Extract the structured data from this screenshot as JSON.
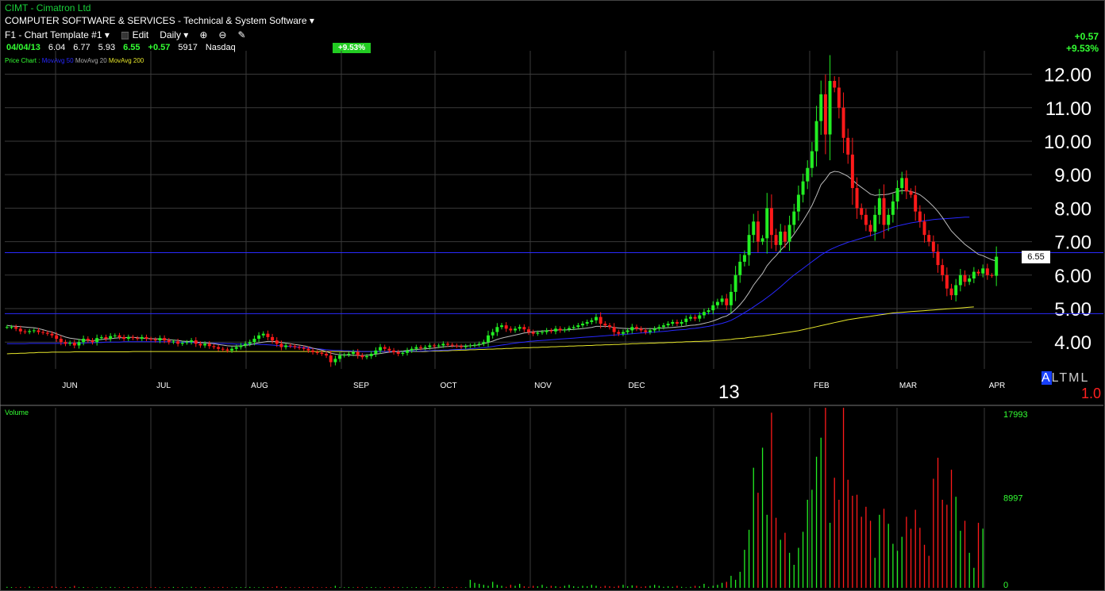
{
  "header": {
    "symbol_line": "CIMT - Cimatron Ltd",
    "industry": "COMPUTER SOFTWARE & SERVICES - Technical & System Software",
    "template": "F1 - Chart Template #1",
    "edit_label": "Edit",
    "period": "Daily"
  },
  "quote": {
    "date": "04/04/13",
    "open": "6.04",
    "high": "6.77",
    "low": "5.93",
    "last": "6.55",
    "change": "+0.57",
    "volume": "5917",
    "exchange": "Nasdaq",
    "pct_badge": "+9.53%"
  },
  "right_change": {
    "points": "+0.57",
    "percent": "+9.53%"
  },
  "legend": {
    "price": "Price Chart :",
    "ma50": "MovAvg 50",
    "ma20": "MovAvg 20",
    "ma200": "MovAvg 200"
  },
  "year_label": "13",
  "scale_modes": {
    "a": "A",
    "l": "L",
    "t": "T",
    "m": "M",
    "l2": "L"
  },
  "scale_value": "1.0",
  "volume_label": "Volume",
  "colors": {
    "up": "#22ee22",
    "down": "#ff1a1a",
    "ma20": "#bbbbbb",
    "ma50": "#2828ff",
    "ma200": "#e6e62a",
    "grid": "#3a3a3a",
    "hline": "#2a2aff"
  },
  "chart_data": [
    {
      "type": "candlestick",
      "title": "CIMT - Cimatron Ltd",
      "y_tick_labels": [
        "12.00",
        "11.00",
        "10.00",
        "9.00",
        "8.00",
        "7.00",
        "6.00",
        "5.00",
        "4.00"
      ],
      "ylim": [
        3.2,
        12.7
      ],
      "month_labels": [
        "JUN",
        "JUL",
        "AUG",
        "SEP",
        "OCT",
        "NOV",
        "DEC",
        "FEB",
        "MAR",
        "APR"
      ],
      "last_price_label": "6.55",
      "horizontal_lines": [
        6.67,
        4.85
      ],
      "close": [
        4.45,
        4.45,
        4.4,
        4.32,
        4.3,
        4.33,
        4.35,
        4.3,
        4.28,
        4.25,
        4.2,
        4.1,
        4.0,
        3.95,
        3.98,
        3.9,
        4.0,
        4.1,
        4.05,
        4.0,
        4.12,
        4.15,
        4.1,
        4.18,
        4.2,
        4.15,
        4.1,
        4.15,
        4.12,
        4.1,
        4.15,
        4.1,
        4.08,
        4.05,
        4.12,
        4.05,
        4.0,
        4.02,
        3.95,
        3.98,
        4.0,
        4.05,
        3.95,
        3.9,
        3.95,
        3.88,
        3.85,
        3.8,
        3.78,
        3.75,
        3.8,
        3.85,
        3.9,
        3.95,
        4.0,
        4.1,
        4.2,
        4.25,
        4.15,
        4.05,
        3.95,
        3.85,
        3.9,
        3.88,
        3.85,
        3.83,
        3.8,
        3.75,
        3.7,
        3.68,
        3.65,
        3.6,
        3.4,
        3.5,
        3.6,
        3.62,
        3.65,
        3.7,
        3.6,
        3.55,
        3.58,
        3.65,
        3.75,
        3.85,
        3.8,
        3.75,
        3.7,
        3.65,
        3.68,
        3.75,
        3.8,
        3.85,
        3.82,
        3.85,
        3.9,
        3.88,
        3.9,
        3.95,
        3.92,
        3.9,
        3.88,
        3.85,
        3.88,
        3.9,
        3.92,
        3.95,
        4.0,
        4.2,
        4.3,
        4.45,
        4.5,
        4.4,
        4.35,
        4.4,
        4.45,
        4.38,
        4.3,
        4.25,
        4.28,
        4.3,
        4.35,
        4.32,
        4.4,
        4.35,
        4.38,
        4.42,
        4.45,
        4.5,
        4.55,
        4.6,
        4.65,
        4.75,
        4.55,
        4.5,
        4.45,
        4.3,
        4.25,
        4.3,
        4.35,
        4.45,
        4.4,
        4.35,
        4.3,
        4.35,
        4.4,
        4.45,
        4.5,
        4.55,
        4.6,
        4.55,
        4.6,
        4.7,
        4.75,
        4.7,
        4.8,
        4.9,
        4.95,
        5.1,
        5.2,
        5.3,
        5.1,
        5.5,
        6.0,
        6.4,
        6.6,
        7.2,
        7.6,
        7.0,
        7.1,
        8.0,
        7.2,
        6.9,
        7.3,
        7.0,
        7.5,
        7.9,
        8.4,
        8.8,
        9.2,
        9.7,
        10.6,
        11.4,
        10.2,
        11.8,
        11.6,
        11.0,
        10.1,
        9.6,
        8.6,
        8.0,
        7.8,
        7.5,
        7.3,
        7.8,
        8.3,
        7.5,
        7.8,
        8.2,
        8.6,
        8.9,
        8.5,
        8.4,
        7.9,
        7.6,
        7.2,
        7.0,
        6.7,
        6.3,
        6.0,
        5.6,
        5.4,
        5.7,
        6.0,
        5.8,
        5.9,
        6.1,
        6.05,
        6.2,
        6.0,
        5.98,
        6.55
      ],
      "ma20": [
        4.5,
        4.48,
        4.47,
        4.46,
        4.45,
        4.44,
        4.43,
        4.4,
        4.37,
        4.33,
        4.3,
        4.25,
        4.2,
        4.15,
        4.12,
        4.1,
        4.08,
        4.06,
        4.05,
        4.04,
        4.06,
        4.08,
        4.09,
        4.1,
        4.12,
        4.13,
        4.13,
        4.14,
        4.14,
        4.13,
        4.12,
        4.11,
        4.1,
        4.1,
        4.09,
        4.08,
        4.07,
        4.06,
        4.05,
        4.03,
        4.02,
        4.02,
        4.0,
        3.99,
        3.98,
        3.97,
        3.95,
        3.93,
        3.91,
        3.89,
        3.88,
        3.88,
        3.89,
        3.9,
        3.92,
        3.95,
        3.98,
        4.0,
        4.02,
        4.02,
        4.01,
        3.99,
        3.97,
        3.95,
        3.93,
        3.91,
        3.89,
        3.86,
        3.82,
        3.79,
        3.76,
        3.72,
        3.67,
        3.64,
        3.62,
        3.62,
        3.61,
        3.61,
        3.6,
        3.6,
        3.61,
        3.62,
        3.64,
        3.66,
        3.68,
        3.7,
        3.71,
        3.72,
        3.73,
        3.75,
        3.76,
        3.78,
        3.79,
        3.8,
        3.81,
        3.82,
        3.84,
        3.86,
        3.87,
        3.88,
        3.88,
        3.88,
        3.88,
        3.89,
        3.9,
        3.92,
        3.95,
        3.99,
        4.03,
        4.08,
        4.12,
        4.15,
        4.18,
        4.21,
        4.24,
        4.27,
        4.29,
        4.31,
        4.32,
        4.33,
        4.34,
        4.35,
        4.36,
        4.36,
        4.36,
        4.37,
        4.38,
        4.39,
        4.4,
        4.42,
        4.44,
        4.47,
        4.47,
        4.47,
        4.46,
        4.44,
        4.42,
        4.41,
        4.4,
        4.4,
        4.4,
        4.4,
        4.4,
        4.4,
        4.4,
        4.41,
        4.42,
        4.43,
        4.44,
        4.45,
        4.46,
        4.48,
        4.5,
        4.51,
        4.53,
        4.56,
        4.59,
        4.63,
        4.68,
        4.74,
        4.78,
        4.86,
        4.98,
        5.12,
        5.28,
        5.48,
        5.7,
        5.88,
        6.05,
        6.28,
        6.44,
        6.58,
        6.74,
        6.88,
        7.04,
        7.22,
        7.42,
        7.62,
        7.84,
        8.08,
        8.38,
        8.7,
        8.86,
        9.05,
        9.1,
        9.08,
        9.02,
        8.95,
        8.84,
        8.72,
        8.62,
        8.52,
        8.42,
        8.38,
        8.4,
        8.4,
        8.42,
        8.46,
        8.5,
        8.52,
        8.52,
        8.5,
        8.46,
        8.4,
        8.3,
        8.18,
        8.05,
        7.9,
        7.72,
        7.52,
        7.32,
        7.18,
        7.05,
        6.92,
        6.82,
        6.72,
        6.62,
        6.58,
        6.52,
        6.46,
        6.42
      ],
      "ma50": [
        3.95,
        3.95,
        3.95,
        3.95,
        3.95,
        3.96,
        3.96,
        3.96,
        3.96,
        3.96,
        3.96,
        3.96,
        3.96,
        3.96,
        3.97,
        3.97,
        3.97,
        3.97,
        3.98,
        3.98,
        3.99,
        3.99,
        4.0,
        4.0,
        4.0,
        4.0,
        4.01,
        4.01,
        4.01,
        4.01,
        4.01,
        4.01,
        4.01,
        4.01,
        4.01,
        4.01,
        4.01,
        4.0,
        4.0,
        4.0,
        3.99,
        3.99,
        3.98,
        3.98,
        3.98,
        3.97,
        3.97,
        3.96,
        3.96,
        3.95,
        3.95,
        3.94,
        3.94,
        3.94,
        3.94,
        3.94,
        3.93,
        3.93,
        3.92,
        3.91,
        3.9,
        3.89,
        3.88,
        3.87,
        3.86,
        3.85,
        3.84,
        3.82,
        3.81,
        3.8,
        3.79,
        3.77,
        3.76,
        3.75,
        3.75,
        3.74,
        3.74,
        3.73,
        3.73,
        3.72,
        3.72,
        3.72,
        3.72,
        3.72,
        3.72,
        3.72,
        3.72,
        3.72,
        3.72,
        3.72,
        3.73,
        3.73,
        3.73,
        3.74,
        3.74,
        3.75,
        3.75,
        3.76,
        3.76,
        3.77,
        3.78,
        3.78,
        3.79,
        3.8,
        3.81,
        3.82,
        3.83,
        3.85,
        3.87,
        3.89,
        3.91,
        3.93,
        3.95,
        3.97,
        3.99,
        4.0,
        4.02,
        4.03,
        4.04,
        4.05,
        4.06,
        4.07,
        4.08,
        4.09,
        4.1,
        4.11,
        4.12,
        4.13,
        4.14,
        4.15,
        4.16,
        4.17,
        4.18,
        4.19,
        4.2,
        4.21,
        4.22,
        4.23,
        4.24,
        4.25,
        4.26,
        4.27,
        4.28,
        4.29,
        4.3,
        4.31,
        4.32,
        4.33,
        4.35,
        4.36,
        4.37,
        4.38,
        4.4,
        4.41,
        4.43,
        4.45,
        4.47,
        4.5,
        4.53,
        4.56,
        4.6,
        4.65,
        4.72,
        4.8,
        4.88,
        4.96,
        5.05,
        5.14,
        5.23,
        5.33,
        5.43,
        5.54,
        5.65,
        5.77,
        5.89,
        6.0,
        6.1,
        6.2,
        6.3,
        6.4,
        6.5,
        6.6,
        6.68,
        6.76,
        6.82,
        6.88,
        6.93,
        6.98,
        7.02,
        7.06,
        7.1,
        7.14,
        7.18,
        7.22,
        7.27,
        7.33,
        7.38,
        7.43,
        7.47,
        7.5,
        7.53,
        7.56,
        7.58,
        7.6,
        7.62,
        7.64,
        7.66,
        7.67,
        7.68,
        7.69,
        7.7,
        7.71,
        7.72,
        7.73,
        7.73
      ],
      "ma200": [
        3.65,
        3.66,
        3.66,
        3.67,
        3.67,
        3.68,
        3.68,
        3.69,
        3.69,
        3.69,
        3.7,
        3.7,
        3.7,
        3.7,
        3.7,
        3.71,
        3.71,
        3.71,
        3.71,
        3.71,
        3.71,
        3.71,
        3.71,
        3.71,
        3.71,
        3.71,
        3.71,
        3.71,
        3.72,
        3.72,
        3.72,
        3.72,
        3.72,
        3.72,
        3.72,
        3.72,
        3.72,
        3.72,
        3.72,
        3.72,
        3.72,
        3.72,
        3.72,
        3.72,
        3.72,
        3.72,
        3.72,
        3.72,
        3.72,
        3.72,
        3.72,
        3.72,
        3.72,
        3.72,
        3.72,
        3.72,
        3.72,
        3.72,
        3.72,
        3.72,
        3.72,
        3.72,
        3.72,
        3.72,
        3.72,
        3.72,
        3.72,
        3.72,
        3.72,
        3.72,
        3.72,
        3.72,
        3.72,
        3.72,
        3.72,
        3.72,
        3.72,
        3.72,
        3.72,
        3.72,
        3.72,
        3.72,
        3.72,
        3.72,
        3.72,
        3.72,
        3.72,
        3.72,
        3.72,
        3.72,
        3.72,
        3.72,
        3.72,
        3.72,
        3.73,
        3.73,
        3.73,
        3.74,
        3.74,
        3.75,
        3.75,
        3.76,
        3.76,
        3.77,
        3.77,
        3.78,
        3.78,
        3.79,
        3.79,
        3.8,
        3.8,
        3.81,
        3.81,
        3.82,
        3.82,
        3.83,
        3.83,
        3.84,
        3.84,
        3.85,
        3.85,
        3.86,
        3.86,
        3.87,
        3.87,
        3.88,
        3.88,
        3.89,
        3.89,
        3.9,
        3.9,
        3.91,
        3.91,
        3.92,
        3.92,
        3.93,
        3.93,
        3.94,
        3.94,
        3.95,
        3.95,
        3.96,
        3.96,
        3.97,
        3.97,
        3.98,
        3.98,
        3.99,
        3.99,
        4.0,
        4.0,
        4.01,
        4.01,
        4.02,
        4.02,
        4.03,
        4.03,
        4.04,
        4.05,
        4.06,
        4.07,
        4.08,
        4.1,
        4.11,
        4.12,
        4.14,
        4.15,
        4.17,
        4.18,
        4.2,
        4.22,
        4.24,
        4.26,
        4.28,
        4.3,
        4.32,
        4.34,
        4.37,
        4.4,
        4.43,
        4.46,
        4.49,
        4.52,
        4.55,
        4.58,
        4.61,
        4.64,
        4.67,
        4.69,
        4.71,
        4.73,
        4.75,
        4.77,
        4.79,
        4.81,
        4.83,
        4.85,
        4.87,
        4.88,
        4.89,
        4.9,
        4.91,
        4.92,
        4.93,
        4.94,
        4.95,
        4.96,
        4.97,
        4.98,
        4.99,
        5.0,
        5.01,
        5.02,
        5.03,
        5.04,
        5.05
      ]
    },
    {
      "type": "bar",
      "title": "Volume",
      "y_tick_labels": [
        "17993",
        "8997",
        "0"
      ],
      "ylim": [
        0,
        17993
      ],
      "values": [
        100,
        80,
        60,
        90,
        50,
        120,
        40,
        70,
        60,
        50,
        150,
        90,
        60,
        80,
        70,
        200,
        60,
        80,
        50,
        40,
        60,
        70,
        50,
        90,
        60,
        50,
        70,
        80,
        60,
        90,
        50,
        70,
        60,
        80,
        50,
        60,
        70,
        90,
        60,
        80,
        50,
        100,
        70,
        60,
        80,
        50,
        60,
        70,
        90,
        60,
        50,
        80,
        70,
        60,
        90,
        50,
        60,
        70,
        80,
        60,
        150,
        90,
        70,
        60,
        50,
        80,
        60,
        70,
        90,
        60,
        50,
        80,
        60,
        200,
        70,
        60,
        80,
        50,
        90,
        60,
        70,
        80,
        60,
        50,
        70,
        60,
        90,
        80,
        60,
        70,
        50,
        80,
        60,
        70,
        90,
        60,
        50,
        80,
        70,
        60,
        90,
        50,
        60,
        800,
        500,
        400,
        300,
        200,
        600,
        300,
        200,
        100,
        300,
        200,
        400,
        150,
        100,
        200,
        150,
        300,
        100,
        200,
        150,
        100,
        200,
        300,
        150,
        100,
        200,
        150,
        300,
        200,
        100,
        200,
        150,
        100,
        200,
        300,
        150,
        250,
        200,
        100,
        150,
        200,
        300,
        200,
        100,
        150,
        100,
        200,
        100,
        50,
        100,
        200,
        150,
        400,
        100,
        200,
        300,
        500,
        600,
        1200,
        800,
        1600,
        3800,
        5800,
        12000,
        9500,
        14000,
        7300,
        17500,
        7000,
        4800,
        5500,
        3500,
        2300,
        4000,
        5600,
        8800,
        9800,
        13100,
        15000,
        17993,
        6500,
        11000,
        8800,
        17993,
        10800,
        9200,
        9300,
        7100,
        8100,
        6700,
        3000,
        7300,
        7900,
        6400,
        4400,
        3700,
        5100,
        7100,
        5900,
        7800,
        6000,
        4300,
        3200,
        10900,
        13000,
        8800,
        8300,
        11800,
        9100,
        5700,
        6700,
        3500,
        2000,
        6500,
        5917
      ]
    }
  ]
}
